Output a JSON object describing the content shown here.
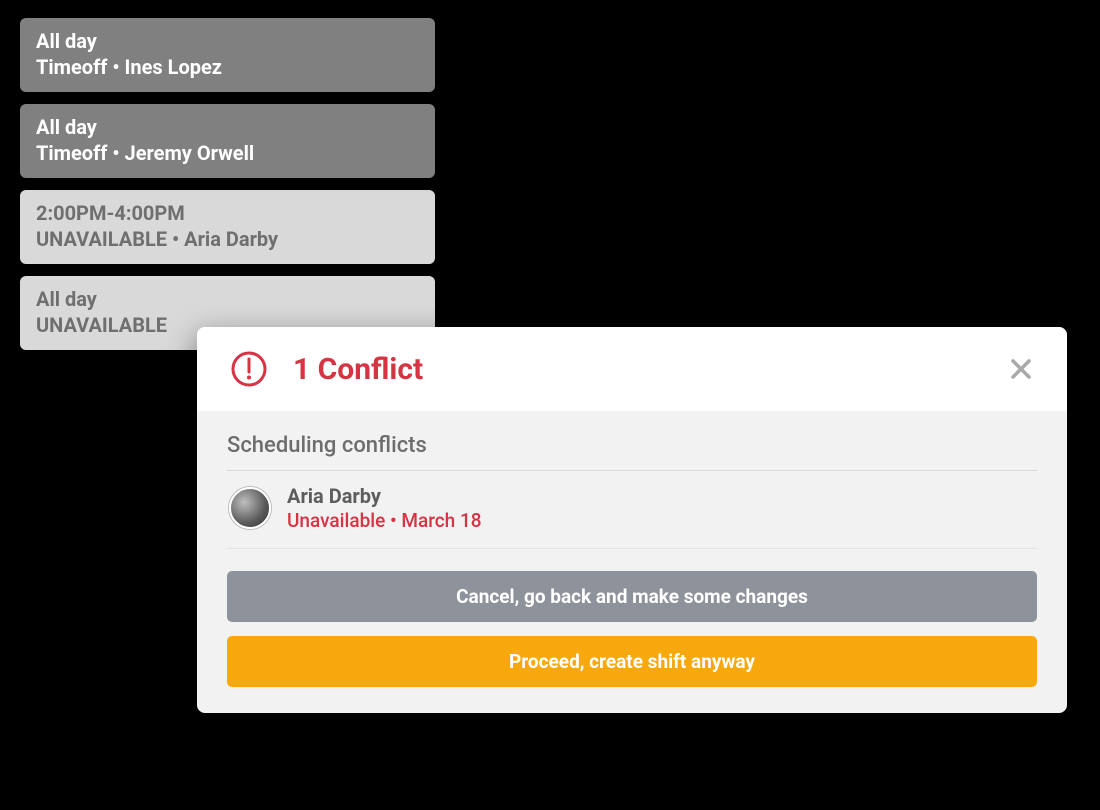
{
  "cards": [
    {
      "line1": "All day",
      "line2": "Timeoff • Ines Lopez",
      "variant": "dark"
    },
    {
      "line1": "All day",
      "line2": "Timeoff • Jeremy Orwell",
      "variant": "dark"
    },
    {
      "line1": "2:00PM-4:00PM",
      "line2": "UNAVAILABLE • Aria Darby",
      "variant": "light"
    },
    {
      "line1": "All day",
      "line2": "UNAVAILABLE",
      "variant": "light"
    }
  ],
  "dialog": {
    "title": "1 Conflict",
    "section_title": "Scheduling conflicts",
    "conflict": {
      "name": "Aria Darby",
      "detail": "Unavailable • March 18"
    },
    "cancel_label": "Cancel, go back and make some changes",
    "proceed_label": "Proceed, create shift anyway"
  },
  "colors": {
    "danger": "#d63343",
    "primary": "#f7a80d",
    "muted_button": "#8e939b"
  }
}
